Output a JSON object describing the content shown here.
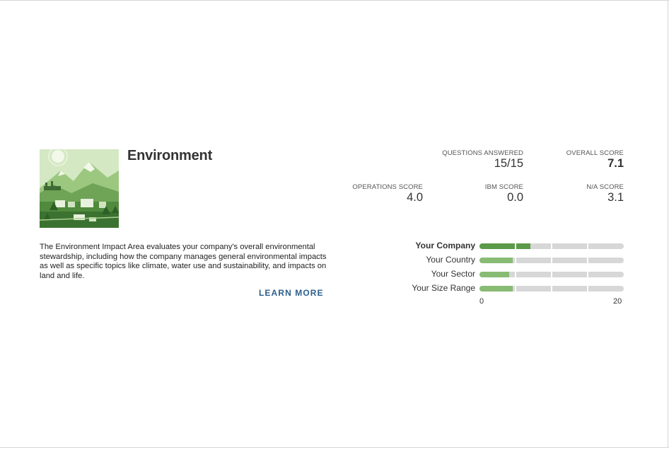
{
  "card": {
    "title": "Environment",
    "description": "The Environment Impact Area evaluates your company's overall environmental stewardship, including how the company manages general environmental impacts as well as specific topics like climate, water use and sustainability, and impacts on land and life.",
    "learn_more": "LEARN MORE"
  },
  "stats": {
    "questions_answered": {
      "label": "QUESTIONS ANSWERED",
      "value": "15/15"
    },
    "overall_score": {
      "label": "OVERALL SCORE",
      "value": "7.1"
    },
    "operations_score": {
      "label": "OPERATIONS SCORE",
      "value": "4.0"
    },
    "ibm_score": {
      "label": "IBM SCORE",
      "value": "0.0"
    },
    "na_score": {
      "label": "N/A SCORE",
      "value": "3.1"
    }
  },
  "chart_data": {
    "type": "bar",
    "orientation": "horizontal",
    "categories": [
      "Your Company",
      "Your Country",
      "Your Sector",
      "Your Size Range"
    ],
    "values": [
      7.1,
      4.6,
      4.1,
      4.6
    ],
    "xlim": [
      0,
      20
    ],
    "tick_labels": [
      "0",
      "20"
    ],
    "colors": {
      "your_company": "#5b9a48",
      "benchmark": "#88bb73",
      "track": "#d7d7d7"
    }
  }
}
